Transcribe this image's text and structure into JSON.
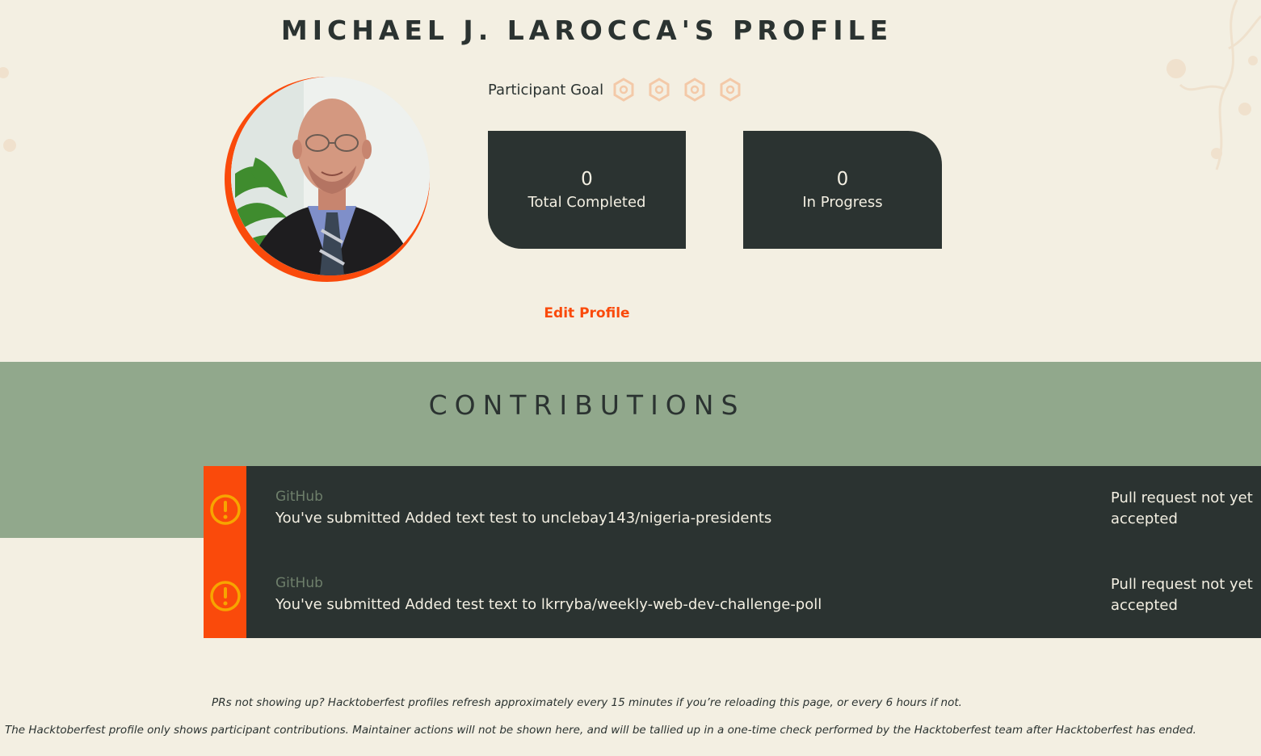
{
  "profile": {
    "title": "MICHAEL J. LAROCCA'S PROFILE",
    "avatar_alt": "Michael J. LaRocca avatar",
    "goal_label": "Participant Goal",
    "goal_progress": {
      "completed": 0,
      "total": 4
    },
    "goal_icon": "hacktoberfest-badge-icon",
    "stats": [
      {
        "value": "0",
        "label": "Total Completed"
      },
      {
        "value": "0",
        "label": "In Progress"
      }
    ],
    "edit_label": "Edit Profile"
  },
  "contributions": {
    "title": "CONTRIBUTIONS",
    "items": [
      {
        "source": "GitHub",
        "description": "You've submitted Added text test to unclebay143/nigeria-presidents",
        "status": "Pull request not yet accepted",
        "icon": "warning-icon"
      },
      {
        "source": "GitHub",
        "description": "You've submitted Added test text to lkrryba/weekly-web-dev-challenge-poll",
        "status": "Pull request not yet accepted",
        "icon": "warning-icon"
      }
    ]
  },
  "notes": {
    "refresh": "PRs not showing up? Hacktoberfest profiles refresh approximately every 15 minutes if you’re reloading this page, or every 6 hours if not.",
    "maintainer": "The Hacktoberfest profile only shows participant contributions. Maintainer actions will not be shown here, and will be tallied up in a one-time check performed by the Hacktoberfest team after Hacktoberfest has ended."
  },
  "colors": {
    "background": "#f3efe2",
    "dark": "#2b3331",
    "accent": "#fa4a0b",
    "band": "#91a88c",
    "warning": "#f7a500"
  }
}
